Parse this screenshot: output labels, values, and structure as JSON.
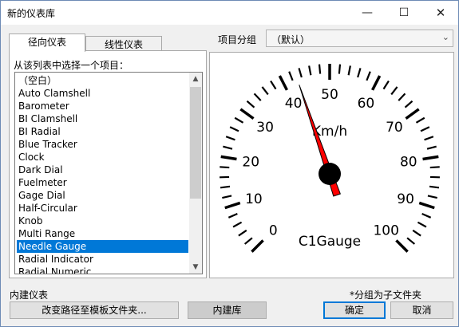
{
  "window": {
    "title": "新的仪表库",
    "minimize_icon": "minimize-icon",
    "maximize_icon": "maximize-icon",
    "close_icon": "close-icon"
  },
  "tabs": [
    {
      "label": "径向仪表",
      "selected": true
    },
    {
      "label": "线性仪表",
      "selected": false
    }
  ],
  "group": {
    "label": "项目分组",
    "value": "（默认）"
  },
  "list": {
    "prompt": "从该列表中选择一个项目：",
    "items": [
      "（空白）",
      "Auto Clamshell",
      "Barometer",
      "BI Clamshell",
      "BI Radial",
      "Blue Tracker",
      "Clock",
      "Dark Dial",
      "Fuelmeter",
      "Gage Dial",
      "Half-Circular",
      "Knob",
      "Multi Range",
      "Needle Gauge",
      "Radial Indicator",
      "Radial Numeric"
    ],
    "selected": "Needle Gauge"
  },
  "gauge": {
    "unit": "Km/h",
    "name": "C1Gauge",
    "min": 0,
    "max": 100,
    "tick_labels": [
      "0",
      "10",
      "20",
      "30",
      "40",
      "50",
      "60",
      "70",
      "80",
      "90",
      "100"
    ],
    "value": 43,
    "needle_color": "#ff0000",
    "hub_color": "#000000"
  },
  "footer": {
    "left_label": "内建仪表",
    "right_label": "*分组为子文件夹",
    "path_button": "改变路径至模板文件夹...",
    "builtin_button": "内建库",
    "ok_button": "确定",
    "cancel_button": "取消"
  }
}
